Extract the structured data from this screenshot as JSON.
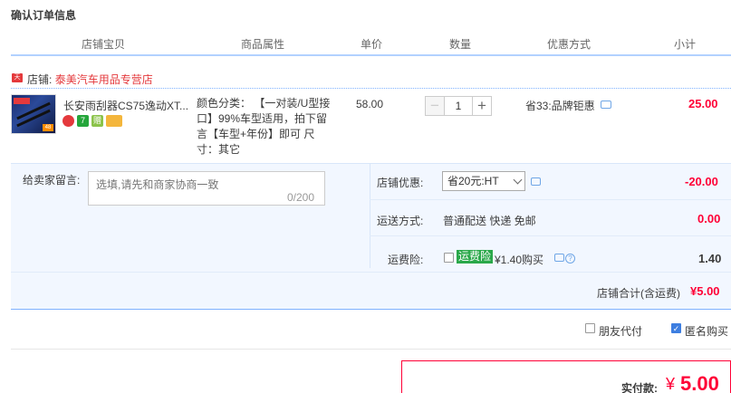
{
  "page_title": "确认订单信息",
  "columns": [
    "店铺宝贝",
    "商品属性",
    "单价",
    "数量",
    "优惠方式",
    "小计"
  ],
  "shop": {
    "badge": "天猫",
    "label": "店铺:",
    "name": "泰美汽车用品专营店"
  },
  "item": {
    "name": "长安雨刮器CS75逸动XT...",
    "thumb_num": "48",
    "attributes": "颜色分类： 【一对装/U型接口】99%车型适用，拍下留言【车型+年份】即可 尺寸：其它",
    "price": "58.00",
    "quantity": "1",
    "minus": "−",
    "plus": "+",
    "promotion": "省33:品牌钜惠",
    "subtotal": "25.00",
    "service_icons": [
      "",
      "7",
      "赠",
      ""
    ]
  },
  "message": {
    "label": "给卖家留言:",
    "placeholder": "选填,请先和商家协商一致",
    "counter": "0/200"
  },
  "shop_discount": {
    "label": "店铺优惠:",
    "selected": "省20元:HT",
    "amount": "-20.00"
  },
  "shipping": {
    "label": "运送方式:",
    "method": "普通配送 快递 免邮",
    "amount": "0.00"
  },
  "insurance": {
    "label": "运费险:",
    "tag": "运费险",
    "text": "¥1.40购买",
    "amount": "1.40"
  },
  "shop_total": {
    "label": "店铺合计(含运费)",
    "amount": "¥5.00"
  },
  "options": {
    "friend_pay": "朋友代付",
    "anonymous": "匿名购买"
  },
  "payment": {
    "label": "实付款:",
    "currency": "¥",
    "amount": "5.00"
  },
  "colors": {
    "accent_red": "#ff0036",
    "shop_red": "#e4393c",
    "panel_bg": "#f2f7ff",
    "insurance_green": "#2aa84a"
  }
}
